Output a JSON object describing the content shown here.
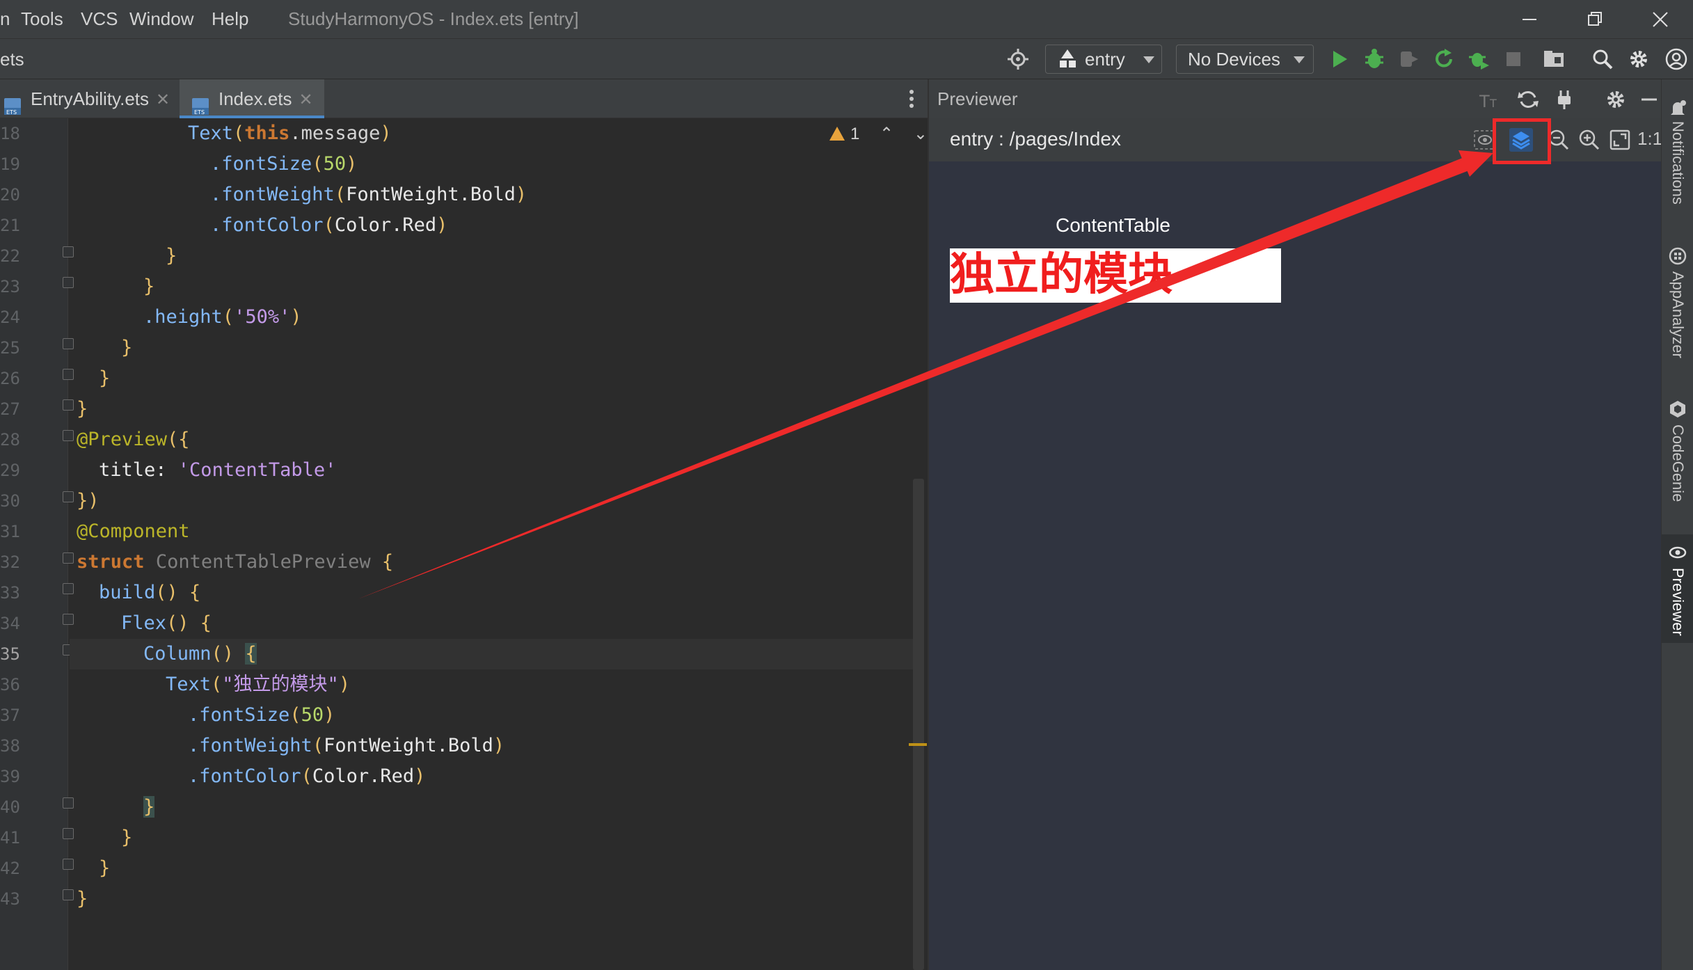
{
  "menu": {
    "first_fragment": "n",
    "tools": "Tools",
    "vcs": "VCS",
    "window": "Window",
    "help": "Help"
  },
  "window_title": "StudyHarmonyOS - Index.ets [entry]",
  "navbar": {
    "breadcrumb": "ets",
    "run_config": "entry",
    "device": "No Devices"
  },
  "tabs": [
    {
      "label": "EntryAbility.ets",
      "active": false
    },
    {
      "label": "Index.ets",
      "active": true
    }
  ],
  "editor": {
    "warnings": "1",
    "line_numbers": [
      "18",
      "19",
      "20",
      "21",
      "22",
      "23",
      "24",
      "25",
      "26",
      "27",
      "28",
      "29",
      "30",
      "31",
      "32",
      "33",
      "34",
      "35",
      "36",
      "37",
      "38",
      "39",
      "40",
      "41",
      "42",
      "43"
    ],
    "current_line": "35",
    "code": {
      "l18_fn": "Text",
      "l18_this": "this",
      "l18_rest": ".message",
      "fontSize": ".fontSize",
      "fontWeight": ".fontWeight",
      "fontColor": ".fontColor",
      "fontsize_val": "50",
      "fontweight_val": "FontWeight.Bold",
      "fontcolor_val": "Color.Red",
      "height": ".height",
      "height_val": "'50%'",
      "preview_ann": "@Preview",
      "title_key": "title: ",
      "title_val": "'ContentTable'",
      "component_ann": "@Component",
      "struct_kw": "struct",
      "struct_name": "ContentTablePreview",
      "build": "build",
      "flex": "Flex",
      "column": "Column",
      "text_fn": "Text",
      "text_arg": "\"独立的模块\""
    }
  },
  "previewer": {
    "panel_title": "Previewer",
    "route": "entry : /pages/Index",
    "preview_title": "ContentTable",
    "rendered_text": "独立的模块",
    "zoom_label": "1:1"
  },
  "right_strip": [
    "Notifications",
    "AppAnalyzer",
    "CodeGenie",
    "Previewer"
  ],
  "colors": {
    "accent_red": "#f01e1e",
    "annotation_red": "#ee2a2a",
    "run_green": "#4caf50",
    "tab_underline": "#4a88c7"
  }
}
